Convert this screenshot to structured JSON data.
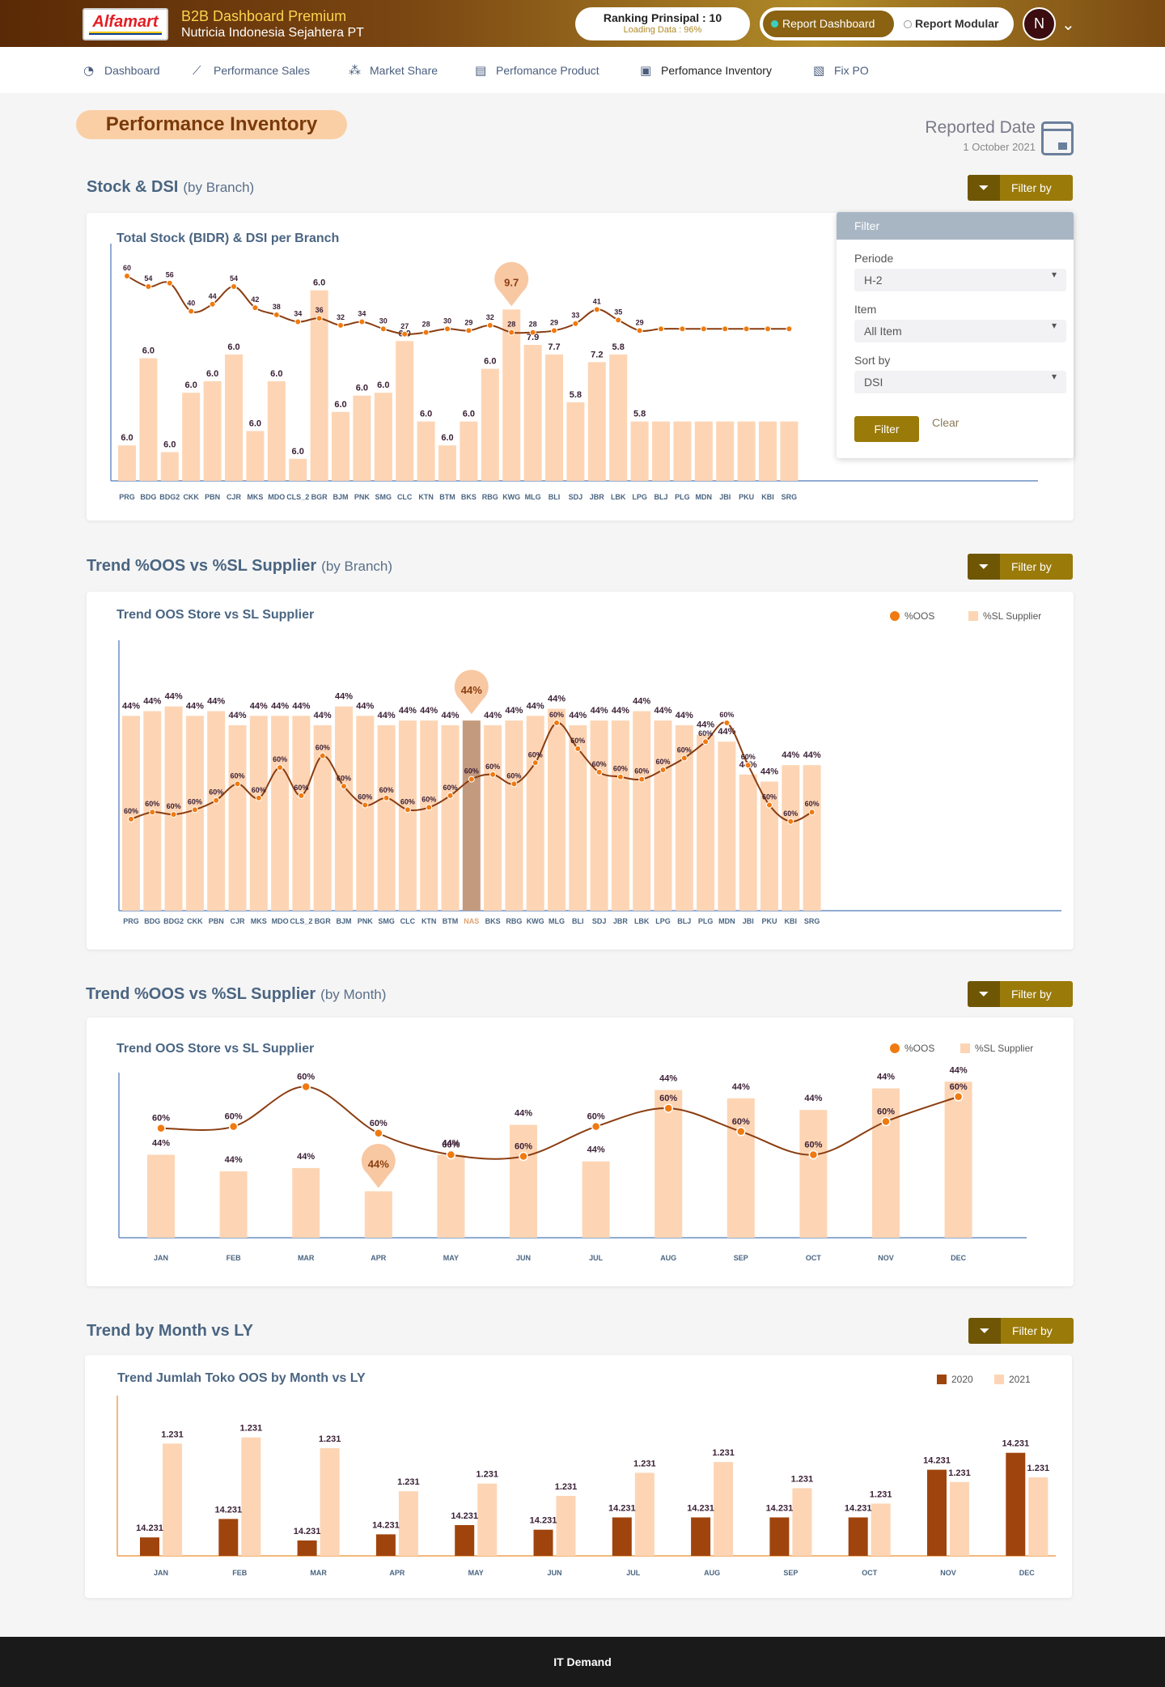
{
  "header": {
    "logo": "Alfamart",
    "title": "B2B Dashboard Premium",
    "subtitle": "Nutricia Indonesia Sejahtera PT",
    "ranking": "Ranking Prinsipal : 10",
    "loading": "Loading Data : 96%",
    "toggle_active": "Report Dashboard",
    "toggle_inactive": "Report Modular",
    "avatar": "N"
  },
  "nav": {
    "items": [
      {
        "label": "Dashboard",
        "icon": "dashboard-icon"
      },
      {
        "label": "Performance Sales",
        "icon": "line-chart-icon"
      },
      {
        "label": "Market Share",
        "icon": "network-icon"
      },
      {
        "label": "Perfomance Product",
        "icon": "bar-chart-icon"
      },
      {
        "label": "Perfomance Inventory",
        "icon": "clipboard-icon"
      },
      {
        "label": "Fix PO",
        "icon": "document-icon"
      }
    ],
    "active": "Perfomance Inventory"
  },
  "page": {
    "title": "Performance Inventory",
    "reported_label": "Reported Date",
    "reported_date": "1 October 2021"
  },
  "sections": {
    "s1_title": "Stock & DSI",
    "s1_sub": "(by Branch)",
    "s2_title": "Trend %OOS vs %SL Supplier",
    "s2_sub": "(by Branch)",
    "s3_title": "Trend %OOS vs %SL Supplier",
    "s3_sub": "(by Month)",
    "s4_title": "Trend by Month vs LY",
    "filter_label": "Filter by"
  },
  "filter_panel": {
    "header": "Filter",
    "periode_label": "Periode",
    "periode_value": "H-2",
    "item_label": "Item",
    "item_value": "All Item",
    "sort_label": "Sort by",
    "sort_value": "DSI",
    "apply": "Filter",
    "clear": "Clear"
  },
  "footer": {
    "text": "IT Demand"
  },
  "colors": {
    "bar": "#fdd5b4",
    "line": "#8a3d10",
    "point": "#f07a10",
    "dark_bar": "#a0440d",
    "highlight": "#c49a7e",
    "axis": "#6b8fc4"
  },
  "chart_data": [
    {
      "type": "bar",
      "title": "Total Stock (BIDR) & DSI per Branch",
      "categories": [
        "PRG",
        "BDG",
        "BDG2",
        "CKK",
        "PBN",
        "CJR",
        "MKS",
        "MDO",
        "CLS_2",
        "BGR",
        "BJM",
        "PNK",
        "SMG",
        "CLC",
        "KTN",
        "BTM",
        "BKS",
        "RBG",
        "KWG",
        "MLG",
        "BLI",
        "SDJ",
        "JBR",
        "LBK",
        "LPG",
        "BLJ",
        "PLG",
        "MDN",
        "JBI",
        "PKU",
        "KBI",
        "SRG"
      ],
      "series": [
        {
          "values": [
            3.7,
            12.8,
            3.0,
            9.2,
            10.4,
            13.2,
            5.2,
            10.4,
            2.3,
            19.9,
            7.2,
            8.9,
            9.2,
            14.6,
            6.2,
            3.7,
            6.2,
            11.7,
            17.9,
            14.2,
            13.2,
            8.2,
            12.4,
            13.2,
            6.2,
            6.2,
            6.2,
            6.2,
            6.2,
            6.2,
            6.2,
            6.2
          ],
          "labels": [
            "6.0",
            "6.0",
            "6.0",
            "6.0",
            "6.0",
            "6.0",
            "6.0",
            "6.0",
            "6.0",
            "6.0",
            "6.0",
            "6.0",
            "6.0",
            "6.0",
            "6.0",
            "6.0",
            "6.0",
            "6.0",
            "9.7",
            "7.9",
            "7.7",
            "5.8",
            "7.2",
            "5.8",
            "5.8",
            "",
            "",
            "",
            "",
            "",
            "",
            ""
          ]
        },
        {
          "values": [
            60,
            54,
            56,
            40,
            44,
            54,
            42,
            38,
            34,
            36,
            32,
            34,
            30,
            27,
            28,
            30,
            29,
            32,
            28,
            28,
            29,
            33,
            41,
            35,
            29,
            30,
            30,
            30,
            30,
            30,
            30,
            30
          ],
          "labels": [
            "60",
            "54",
            "56",
            "40",
            "44",
            "54",
            "42",
            "38",
            "34",
            "36",
            "32",
            "34",
            "30",
            "27",
            "28",
            "30",
            "29",
            "32",
            "28",
            "28",
            "29",
            "33",
            "41",
            "35",
            "29",
            "",
            "",
            "",
            "",
            "",
            "",
            ""
          ]
        }
      ],
      "callout": {
        "index": 18,
        "text": "9.7"
      }
    },
    {
      "type": "bar",
      "title": "Trend OOS Store vs SL Supplier",
      "categories": [
        "PRG",
        "BDG",
        "BDG2",
        "CKK",
        "PBN",
        "CJR",
        "MKS",
        "MDO",
        "CLS_2",
        "BGR",
        "BJM",
        "PNK",
        "SMG",
        "CLC",
        "KTN",
        "BTM",
        "NAS",
        "BKS",
        "RBG",
        "KWG",
        "MLG",
        "BLI",
        "SDJ",
        "JBR",
        "LBK",
        "LPG",
        "BLJ",
        "PLG",
        "MDN",
        "JBI",
        "PKU",
        "KBI",
        "SRG"
      ],
      "series": [
        {
          "name": "%SL Supplier",
          "values": [
            83,
            85,
            87,
            83,
            85,
            79,
            83,
            83,
            83,
            79,
            87,
            83,
            79,
            81,
            81,
            79,
            81,
            79,
            81,
            83,
            86,
            79,
            81,
            81,
            85,
            81,
            79,
            75,
            72,
            58,
            55,
            62,
            62
          ],
          "label": "44%"
        },
        {
          "name": "%OOS",
          "values": [
            39,
            42,
            41,
            43,
            47,
            54,
            48,
            61,
            49,
            66,
            53,
            45,
            48,
            43,
            44,
            49,
            56,
            58,
            54,
            63,
            80,
            69,
            59,
            57,
            56,
            60,
            65,
            72,
            80,
            62,
            45,
            38,
            42
          ],
          "label": "60%"
        }
      ],
      "highlight": {
        "index": 16,
        "text": "44%"
      }
    },
    {
      "type": "bar",
      "title": "Trend OOS Store vs SL Supplier",
      "categories": [
        "JAN",
        "FEB",
        "MAR",
        "APR",
        "MAY",
        "JUN",
        "JUL",
        "AUG",
        "SEP",
        "OCT",
        "NOV",
        "DEC"
      ],
      "series": [
        {
          "name": "%SL Supplier",
          "values": [
            50,
            40,
            42,
            28,
            50,
            68,
            46,
            89,
            84,
            77,
            90,
            94
          ],
          "label": "44%"
        },
        {
          "name": "%OOS",
          "values": [
            66,
            67,
            91,
            63,
            50,
            49,
            67,
            78,
            64,
            50,
            70,
            85
          ],
          "label": "60%"
        }
      ],
      "callout": {
        "index": 3,
        "text": "44%"
      }
    },
    {
      "type": "bar",
      "title": "Trend Jumlah Toko OOS by Month vs LY",
      "categories": [
        "JAN",
        "FEB",
        "MAR",
        "APR",
        "MAY",
        "JUN",
        "JUL",
        "AUG",
        "SEP",
        "OCT",
        "NOV",
        "DEC"
      ],
      "series": [
        {
          "name": "2020",
          "values": [
            12,
            24,
            10,
            14,
            20,
            17,
            25,
            25,
            25,
            25,
            56,
            67
          ],
          "label": "14.231"
        },
        {
          "name": "2021",
          "values": [
            73,
            77,
            70,
            42,
            47,
            39,
            54,
            61,
            44,
            34,
            48,
            51
          ],
          "label": "1.231"
        }
      ]
    }
  ]
}
